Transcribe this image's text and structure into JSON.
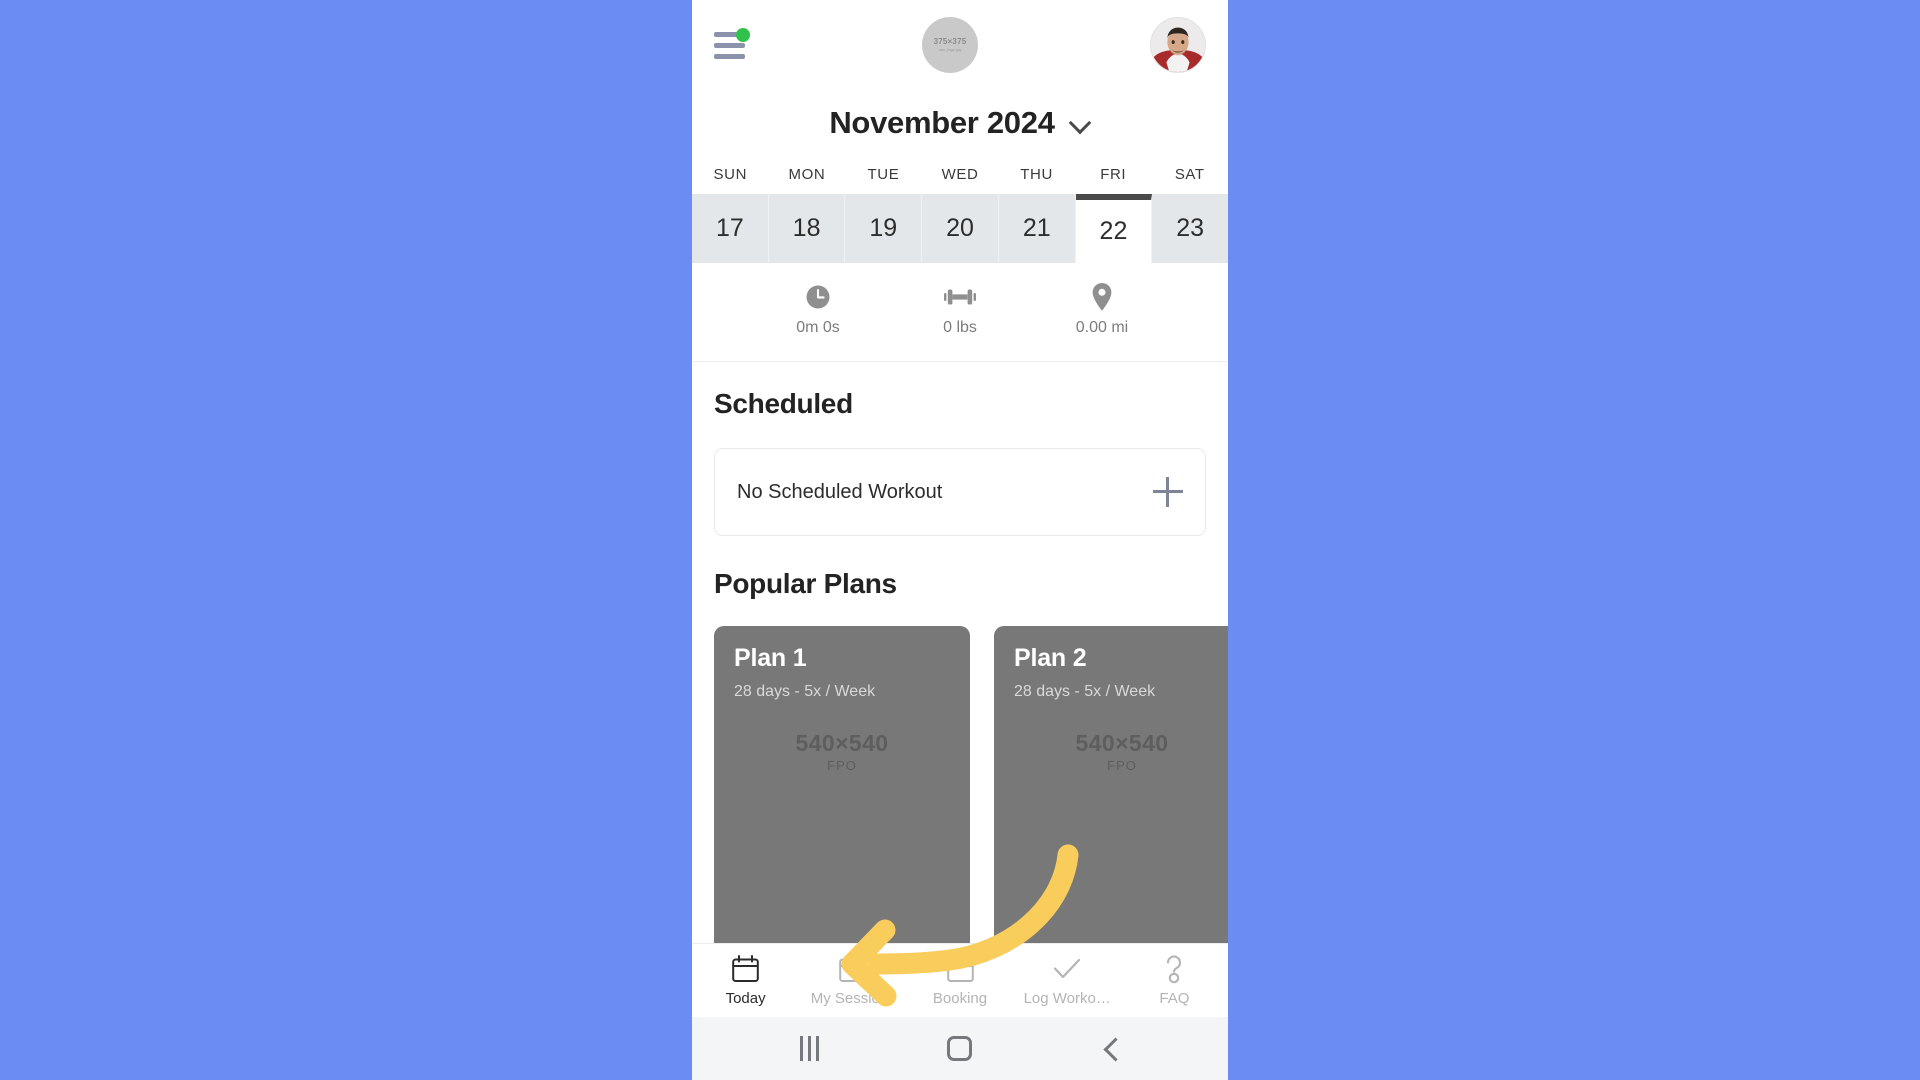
{
  "app": {
    "background_color": "#6b8cf2",
    "accent_color": "#f6c councils"
  },
  "header": {
    "menu_icon": "hamburger-menu-icon",
    "menu_badge": "notification-dot",
    "badge_color": "#31c24d",
    "logo_placeholder": {
      "size_label": "375×375",
      "file_label": "nav_logo.jpg"
    },
    "avatar": "user-avatar"
  },
  "calendar": {
    "month_label": "November 2024",
    "dropdown_icon": "chevron-down-icon",
    "weekdays": [
      "SUN",
      "MON",
      "TUE",
      "WED",
      "THU",
      "FRI",
      "SAT"
    ],
    "dates": [
      "17",
      "18",
      "19",
      "20",
      "21",
      "22",
      "23"
    ],
    "selected_index": 5,
    "selected_date": "22"
  },
  "stats": [
    {
      "icon": "clock-icon",
      "value": "0m  0s"
    },
    {
      "icon": "dumbbell-icon",
      "value": "0 lbs"
    },
    {
      "icon": "location-pin-icon",
      "value": "0.00 mi"
    }
  ],
  "scheduled": {
    "title": "Scheduled",
    "empty_label": "No Scheduled Workout",
    "add_icon": "plus-icon"
  },
  "popular_plans": {
    "title": "Popular Plans",
    "cards": [
      {
        "name": "Plan 1",
        "meta": "28 days - 5x / Week",
        "image_size": "540×540",
        "image_tag": "FPO"
      },
      {
        "name": "Plan 2",
        "meta": "28 days - 5x / Week",
        "image_size": "540×540",
        "image_tag": "FPO"
      }
    ]
  },
  "tabbar": {
    "active_index": 0,
    "tabs": [
      {
        "label": "Today",
        "icon": "calendar-icon"
      },
      {
        "label": "My Sessio…",
        "icon": "calendar-icon"
      },
      {
        "label": "Booking",
        "icon": "calendar-icon"
      },
      {
        "label": "Log Worko…",
        "icon": "checkmark-icon"
      },
      {
        "label": "FAQ",
        "icon": "question-mark-icon"
      }
    ]
  },
  "system_nav": {
    "recents": "recents-icon",
    "home": "home-icon",
    "back": "back-icon"
  },
  "annotation": {
    "type": "curved-arrow",
    "color": "#f8cd5c",
    "points_to": "My Sessio…"
  }
}
